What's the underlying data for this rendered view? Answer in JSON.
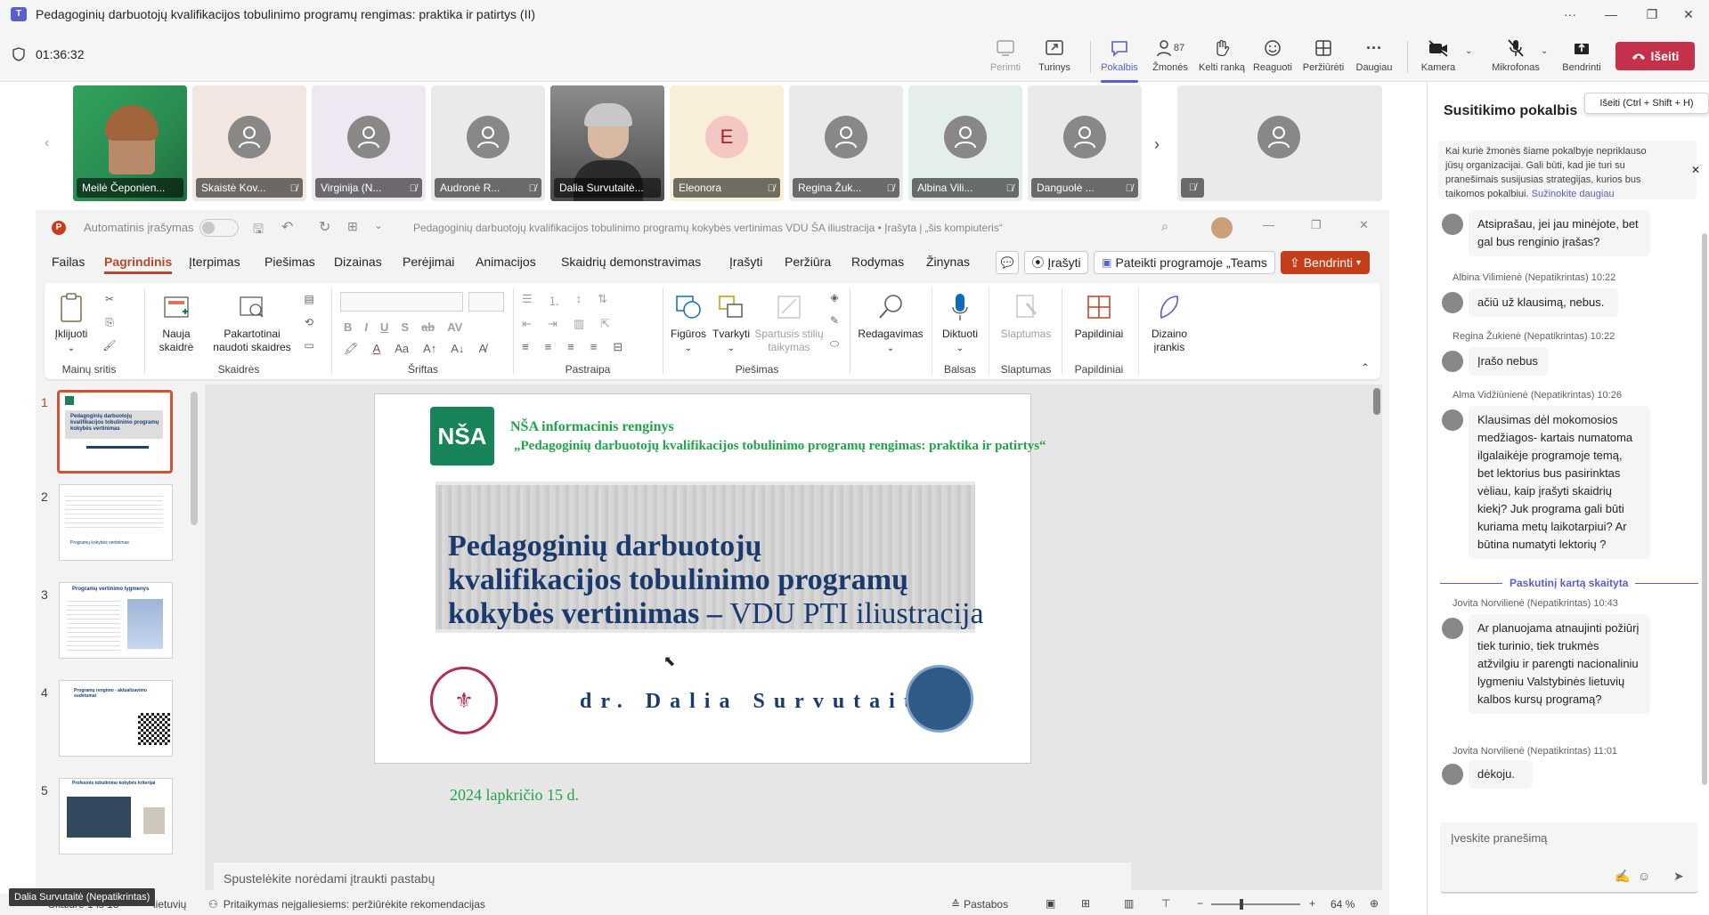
{
  "window": {
    "title": "Pedagoginių darbuotojų kvalifikacijos tobulinimo programų rengimas: praktika ir patirtys (II)"
  },
  "meeting": {
    "timer": "01:36:32",
    "toolbar": {
      "take_control": "Perimti",
      "content": "Turinys",
      "chat": "Pokalbis",
      "people": "Žmonės",
      "people_count": "87",
      "raise_hand": "Kelti ranką",
      "react": "Reaguoti",
      "view": "Peržiūrėti",
      "more": "Daugiau",
      "camera": "Kamera",
      "mic": "Mikrofonas",
      "share": "Bendrinti",
      "leave": "Išeiti"
    },
    "leave_tooltip": "Išeiti (Ctrl + Shift + H)",
    "participants": [
      {
        "name": "Meilė Čeponien...",
        "type": "video"
      },
      {
        "name": "Skaistė Kov...",
        "type": "avatar"
      },
      {
        "name": "Virginija (N...",
        "type": "avatar"
      },
      {
        "name": "Audronė R...",
        "type": "avatar"
      },
      {
        "name": "Dalia Survutaitė...",
        "type": "video"
      },
      {
        "name": "Eleonora",
        "type": "initial",
        "initial": "E"
      },
      {
        "name": "Regina Žuk...",
        "type": "avatar"
      },
      {
        "name": "Albina Vili...",
        "type": "avatar"
      },
      {
        "name": "Danguolė ...",
        "type": "avatar"
      },
      {
        "name": "",
        "type": "avatar"
      }
    ],
    "speaker_label": "Dalia Survutaitė (Nepatikrintas)"
  },
  "powerpoint": {
    "autosave": "Automatinis įrašymas",
    "doc_title": "Pedagoginių darbuotojų kvalifikacijos tobulinimo programų kokybės vertinimas VDU ŠA iliustracija • Įrašyta į „šis kompiuteris“",
    "menus": [
      "Failas",
      "Pagrindinis",
      "Įterpimas",
      "Piešimas",
      "Dizainas",
      "Perėjimai",
      "Animacijos",
      "Skaidrių demonstravimas",
      "Įrašyti",
      "Peržiūra",
      "Rodymas",
      "Žinynas"
    ],
    "record_btn": "Įrašyti",
    "present_teams": "Pateikti programoje „Teams",
    "share_btn": "Bendrinti",
    "ribbon": {
      "paste": "Įklijuoti",
      "clipboard": "Mainų sritis",
      "new_slide": "Nauja skaidrė",
      "reuse_slides": "Pakartotinai naudoti skaidres",
      "slides": "Skaidrės",
      "font": "Šriftas",
      "paragraph": "Pastraipa",
      "shapes": "Figūros",
      "arrange": "Tvarkyti",
      "quick_styles": "Spartusis stilių taikymas",
      "drawing": "Piešimas",
      "editing": "Redagavimas",
      "dictate": "Diktuoti",
      "voice": "Balsas",
      "sensitivity": "Slaptumas",
      "sensitivity_group": "Slaptumas",
      "addins": "Papildiniai",
      "addins_group": "Papildiniai",
      "designer": "Dizaino įrankis"
    },
    "thumbnails": [
      "1",
      "2",
      "3",
      "4",
      "5"
    ],
    "thumb_titles": [
      "Pedagoginių darbuotojų kvalifikacijos tobulinimo programų kokybės vertinimas",
      "Programų kokybės vertinimas",
      "Programų vertinimo lygmenys",
      "Programų rengimo - aktualizavimo sudėtumai",
      "Profesinis tobulinimo kokybės kriterijai"
    ],
    "slide": {
      "org": "NŠA",
      "event": "NŠA informacinis renginys",
      "event_title": "„Pedagoginių darbuotojų kvalifikacijos tobulinimo  programų rengimas: praktika ir patirtys“",
      "title_line1": "Pedagoginių darbuotojų",
      "title_line2": "kvalifikacijos tobulinimo programų",
      "title_line3a": "kokybės vertinimas – ",
      "title_line3b": "VDU PTI iliustracija",
      "author": "dr. Dalia Survutaitė",
      "date": "2024 lapkričio 15 d."
    },
    "notes_placeholder": "Spustelėkite norėdami įtraukti pastabų",
    "status": {
      "slide": "Skaidrė 1 iš 18",
      "language": "lietuvių",
      "accessibility": "Pritaikymas neįgaliesiems: peržiūrėkite rekomendacijas",
      "notes": "Pastabos",
      "zoom": "64 %"
    }
  },
  "chat": {
    "title": "Susitikimo pokalbis",
    "notice": "Kai kurie žmonės šiame pokalbyje nepriklauso jūsų organizacijai. Gali būti, kad jie turi su pranešimais susijusias strategijas, kurios bus taikomos pokalbiui.",
    "notice_link": "Sužinokite daugiau",
    "last_read": "Paskutinį kartą skaityta",
    "messages": [
      {
        "sender": "",
        "time": "",
        "text": "Atsiprašau, jei jau minėjote, bet gal bus renginio  įrašas?"
      },
      {
        "sender": "Albina Vilimienė (Nepatikrintas)",
        "time": "10:22",
        "text": "ačiū už klausimą, nebus."
      },
      {
        "sender": "Regina Žukienė (Nepatikrintas)",
        "time": "10:22",
        "text": "Įrašo nebus"
      },
      {
        "sender": "Alma Vidžiūnienė (Nepatikrintas)",
        "time": "10:26",
        "text": "Klausimas dėl mokomosios medžiagos- kartais numatoma ilgalaikėje programoje temą, bet lektorius bus pasirinktas vėliau, kaip įrašyti skaidrių kiekį? Juk programa gali būti kuriama metų laikotarpiui? Ar būtina numatyti lektorių ?"
      },
      {
        "sender": "Jovita Norvilienė (Nepatikrintas)",
        "time": "10:43",
        "text": "Ar planuojama atnaujinti požiūrį tiek turinio, tiek trukmės atžvilgiu ir parengti nacionaliniu lygmeniu Valstybinės lietuvių kalbos kursų programą?"
      },
      {
        "sender": "Jovita Norvilienė (Nepatikrintas)",
        "time": "11:01",
        "text": "dėkoju."
      }
    ],
    "input_placeholder": "Įveskite pranešimą"
  }
}
